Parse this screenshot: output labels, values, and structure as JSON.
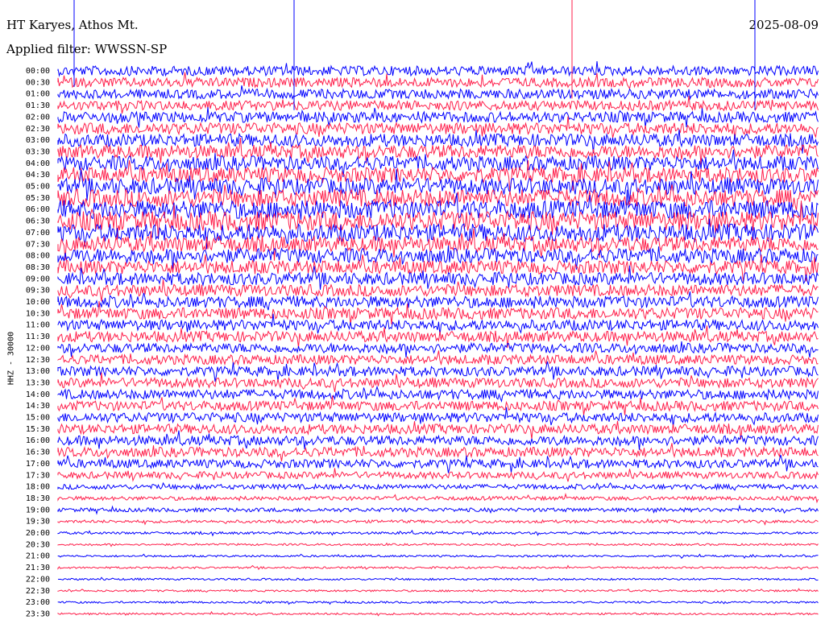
{
  "header": {
    "station": "HT Karyes, Athos Mt.",
    "filter": "Applied filter: WWSSN-SP",
    "date": "2025-08-09"
  },
  "chart_data": {
    "type": "helicorder",
    "channel_label": "HHZ - 30000",
    "line_labels": [
      "00:00",
      "00:30",
      "01:00",
      "01:30",
      "02:00",
      "02:30",
      "03:00",
      "03:30",
      "04:00",
      "04:30",
      "05:00",
      "05:30",
      "06:00",
      "06:30",
      "07:00",
      "07:30",
      "08:00",
      "08:30",
      "09:00",
      "09:30",
      "10:00",
      "10:30",
      "11:00",
      "11:30",
      "12:00",
      "12:30",
      "13:00",
      "13:30",
      "14:00",
      "14:30",
      "15:00",
      "15:30",
      "16:00",
      "16:30",
      "17:00",
      "17:30",
      "18:00",
      "18:30",
      "19:00",
      "19:30",
      "20:00",
      "20:30",
      "21:00",
      "21:30",
      "22:00",
      "22:30",
      "23:00",
      "23:30"
    ],
    "line_colors": [
      "#0000ff",
      "#ff1f4b"
    ],
    "noise_amplitude": [
      1,
      1,
      1,
      1,
      1.1,
      1.2,
      1.3,
      1.4,
      1.5,
      1.6,
      1.7,
      1.8,
      1.9,
      2,
      1.8,
      1.6,
      1.5,
      1.4,
      1.3,
      1.2,
      1.2,
      1.2,
      1.1,
      1.1,
      1,
      1,
      1,
      1,
      1,
      1,
      1,
      1,
      1,
      1,
      0.9,
      0.7,
      0.5,
      0.4,
      0.4,
      0.3,
      0.25,
      0.2,
      0.2,
      0.2,
      0.2,
      0.2,
      0.2,
      0.2
    ]
  }
}
